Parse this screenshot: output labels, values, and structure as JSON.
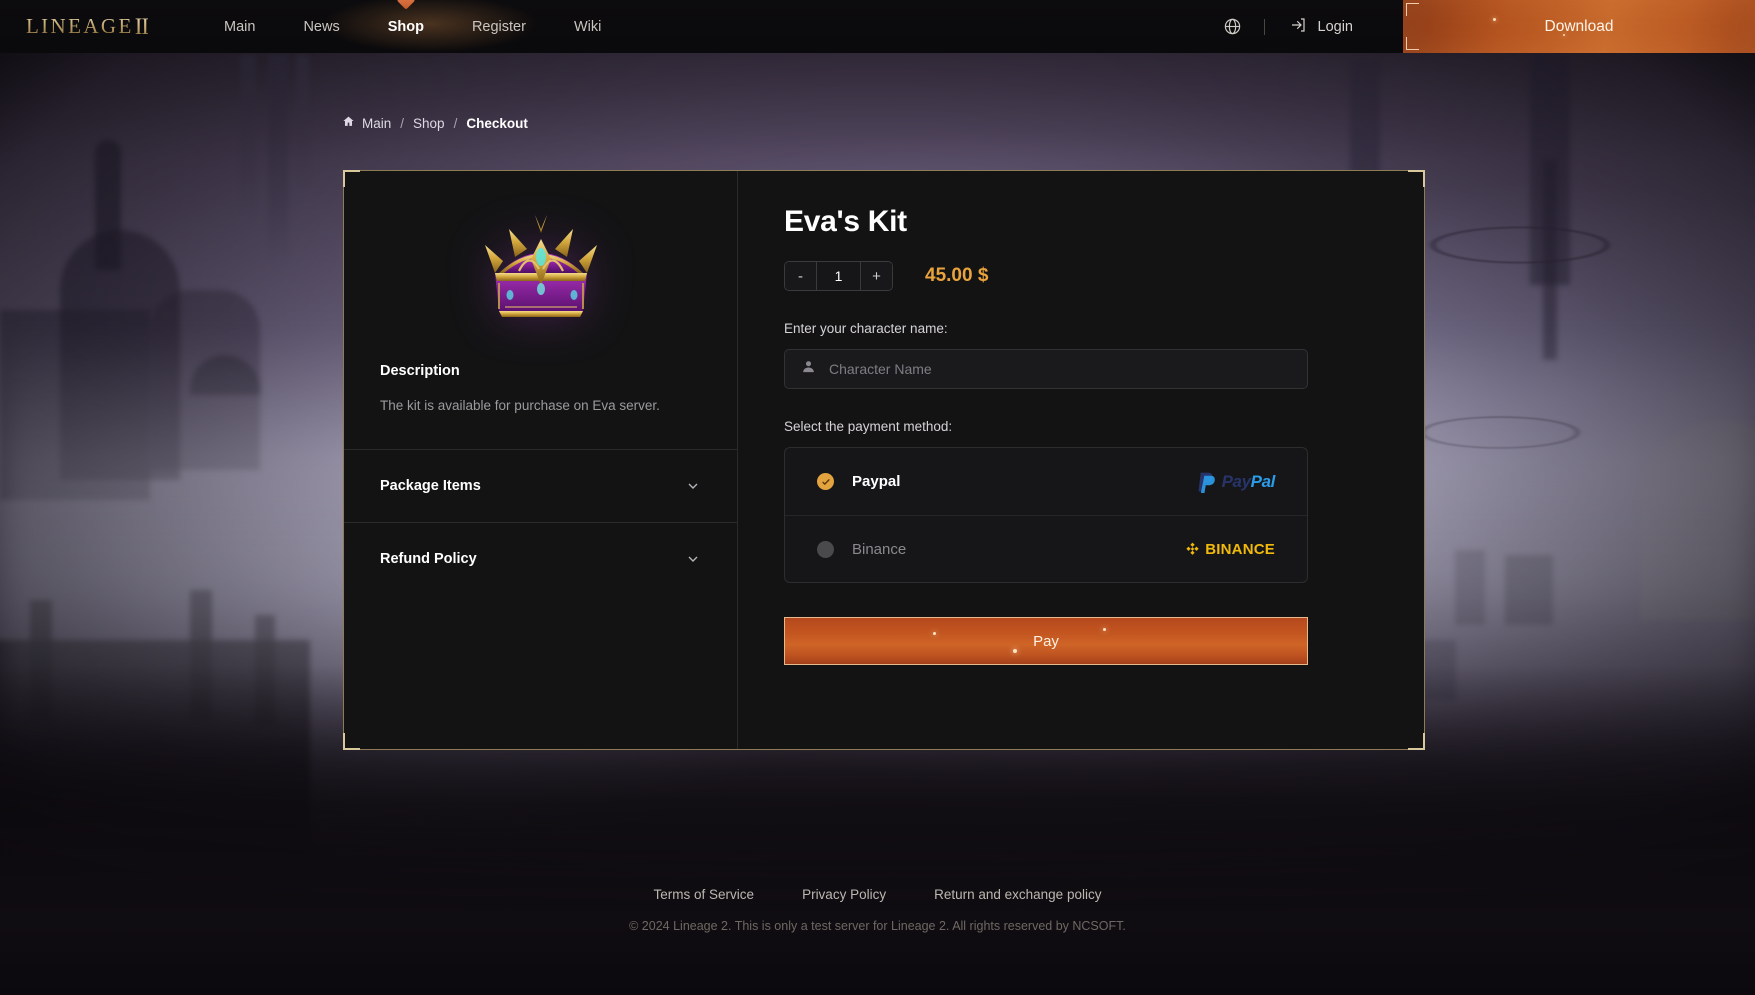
{
  "header": {
    "logo_text": "LINEAGE",
    "logo_numeral": "II",
    "nav": [
      {
        "label": "Main"
      },
      {
        "label": "News"
      },
      {
        "label": "Shop"
      },
      {
        "label": "Register"
      },
      {
        "label": "Wiki"
      }
    ],
    "active_nav": "Shop",
    "language_icon": "globe-icon",
    "login_icon": "login-arrow-icon",
    "login_label": "Login",
    "download_label": "Download"
  },
  "breadcrumb": {
    "home_icon": "home-icon",
    "items": [
      {
        "label": "Main"
      },
      {
        "label": "Shop"
      },
      {
        "label": "Checkout"
      }
    ],
    "separator": "/"
  },
  "product": {
    "image_icon": "treasure-chest-icon",
    "title": "Eva's Kit",
    "quantity": "1",
    "decrement_label": "-",
    "increment_label": "+",
    "price": "45.00 $"
  },
  "left_panel": {
    "description_title": "Description",
    "description_text": "The kit is available for purchase on Eva server.",
    "accordions": [
      {
        "label": "Package Items",
        "icon": "chevron-down-icon"
      },
      {
        "label": "Refund Policy",
        "icon": "chevron-down-icon"
      }
    ]
  },
  "form": {
    "character_label": "Enter your character name:",
    "character_icon": "user-icon",
    "character_value": "",
    "character_placeholder": "Character Name",
    "payment_label": "Select the payment method:",
    "payment_methods": [
      {
        "name": "Paypal",
        "selected": true,
        "logo": "paypal-logo",
        "logo_part_1": "Pay",
        "logo_part_2": "Pal"
      },
      {
        "name": "Binance",
        "selected": false,
        "logo": "binance-logo",
        "logo_text": "BINANCE"
      }
    ],
    "pay_button_label": "Pay"
  },
  "footer": {
    "links": [
      {
        "label": "Terms of Service"
      },
      {
        "label": "Privacy Policy"
      },
      {
        "label": "Return and exchange policy"
      }
    ],
    "copyright": "© 2024 Lineage 2. This is only a test server for Lineage 2. All rights reserved by NCSOFT."
  },
  "colors": {
    "accent_orange": "#e8a33c",
    "button_orange": "#c1541f",
    "card_border": "#8d7c55",
    "paypal_dark": "#27346a",
    "paypal_light": "#2b9ce8",
    "binance_yellow": "#f0b90b"
  }
}
